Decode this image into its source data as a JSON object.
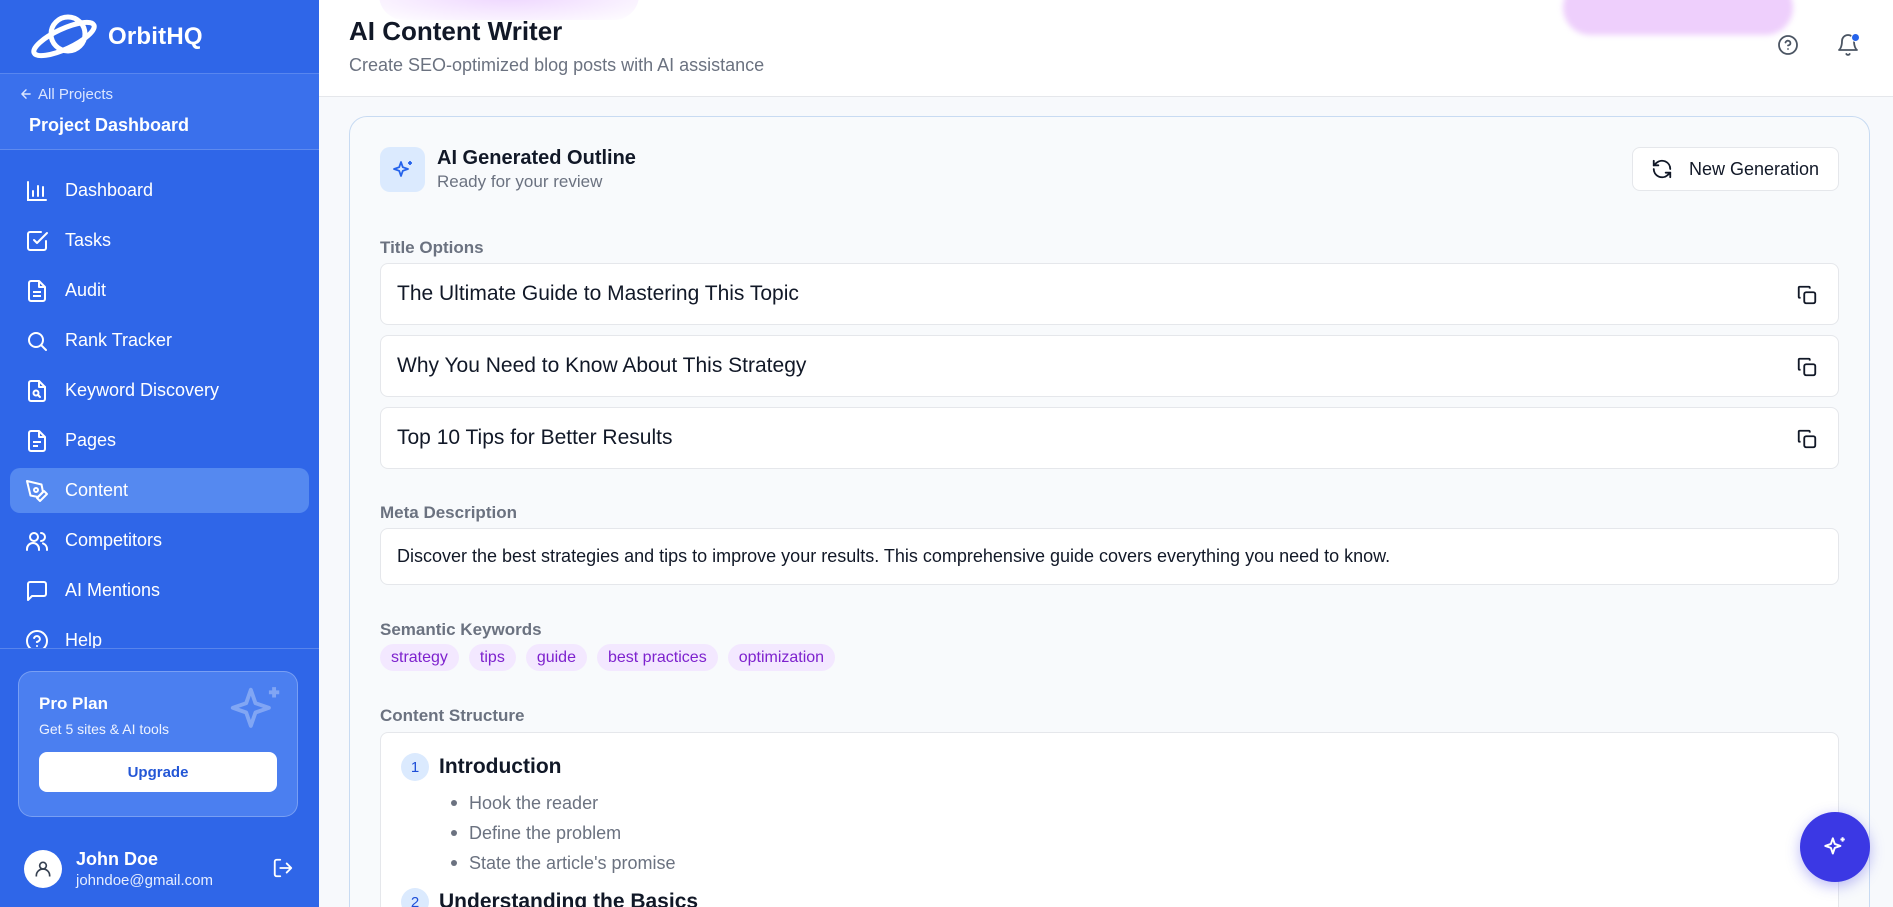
{
  "brand": {
    "name": "OrbitHQ"
  },
  "project": {
    "back_label": "All Projects",
    "title": "Project Dashboard"
  },
  "nav": [
    {
      "label": "Dashboard",
      "icon": "bar-chart-icon"
    },
    {
      "label": "Tasks",
      "icon": "checkbox-icon"
    },
    {
      "label": "Audit",
      "icon": "document-icon"
    },
    {
      "label": "Rank Tracker",
      "icon": "search-icon"
    },
    {
      "label": "Keyword Discovery",
      "icon": "file-search-icon"
    },
    {
      "label": "Pages",
      "icon": "file-text-icon"
    },
    {
      "label": "Content",
      "icon": "pen-tool-icon",
      "active": true
    },
    {
      "label": "Competitors",
      "icon": "users-icon"
    },
    {
      "label": "AI Mentions",
      "icon": "message-square-icon"
    },
    {
      "label": "Help",
      "icon": "help-circle-icon"
    }
  ],
  "pro": {
    "title": "Pro Plan",
    "subtitle": "Get 5 sites & AI tools",
    "button": "Upgrade"
  },
  "user": {
    "name": "John Doe",
    "email": "johndoe@gmail.com"
  },
  "header": {
    "title": "AI Content Writer",
    "subtitle": "Create SEO-optimized blog posts with AI assistance"
  },
  "card": {
    "title": "AI Generated Outline",
    "subtitle": "Ready for your review",
    "new_generation": "New Generation",
    "title_options_label": "Title Options",
    "title_options": [
      "The Ultimate Guide to Mastering This Topic",
      "Why You Need to Know About This Strategy",
      "Top 10 Tips for Better Results"
    ],
    "meta_label": "Meta Description",
    "meta": "Discover the best strategies and tips to improve your results. This comprehensive guide covers everything you need to know.",
    "keywords_label": "Semantic Keywords",
    "keywords": [
      "strategy",
      "tips",
      "guide",
      "best practices",
      "optimization"
    ],
    "structure_label": "Content Structure",
    "sections": [
      {
        "num": "1",
        "title": "Introduction",
        "points": [
          "Hook the reader",
          "Define the problem",
          "State the article's promise"
        ]
      },
      {
        "num": "2",
        "title": "Understanding the Basics",
        "points": []
      }
    ]
  },
  "colors": {
    "sidebar": "#2f66e8",
    "accent": "#2563eb",
    "chip_bg": "#f3e8ff",
    "chip_text": "#7e22ce",
    "fab": "#3b38e4"
  }
}
